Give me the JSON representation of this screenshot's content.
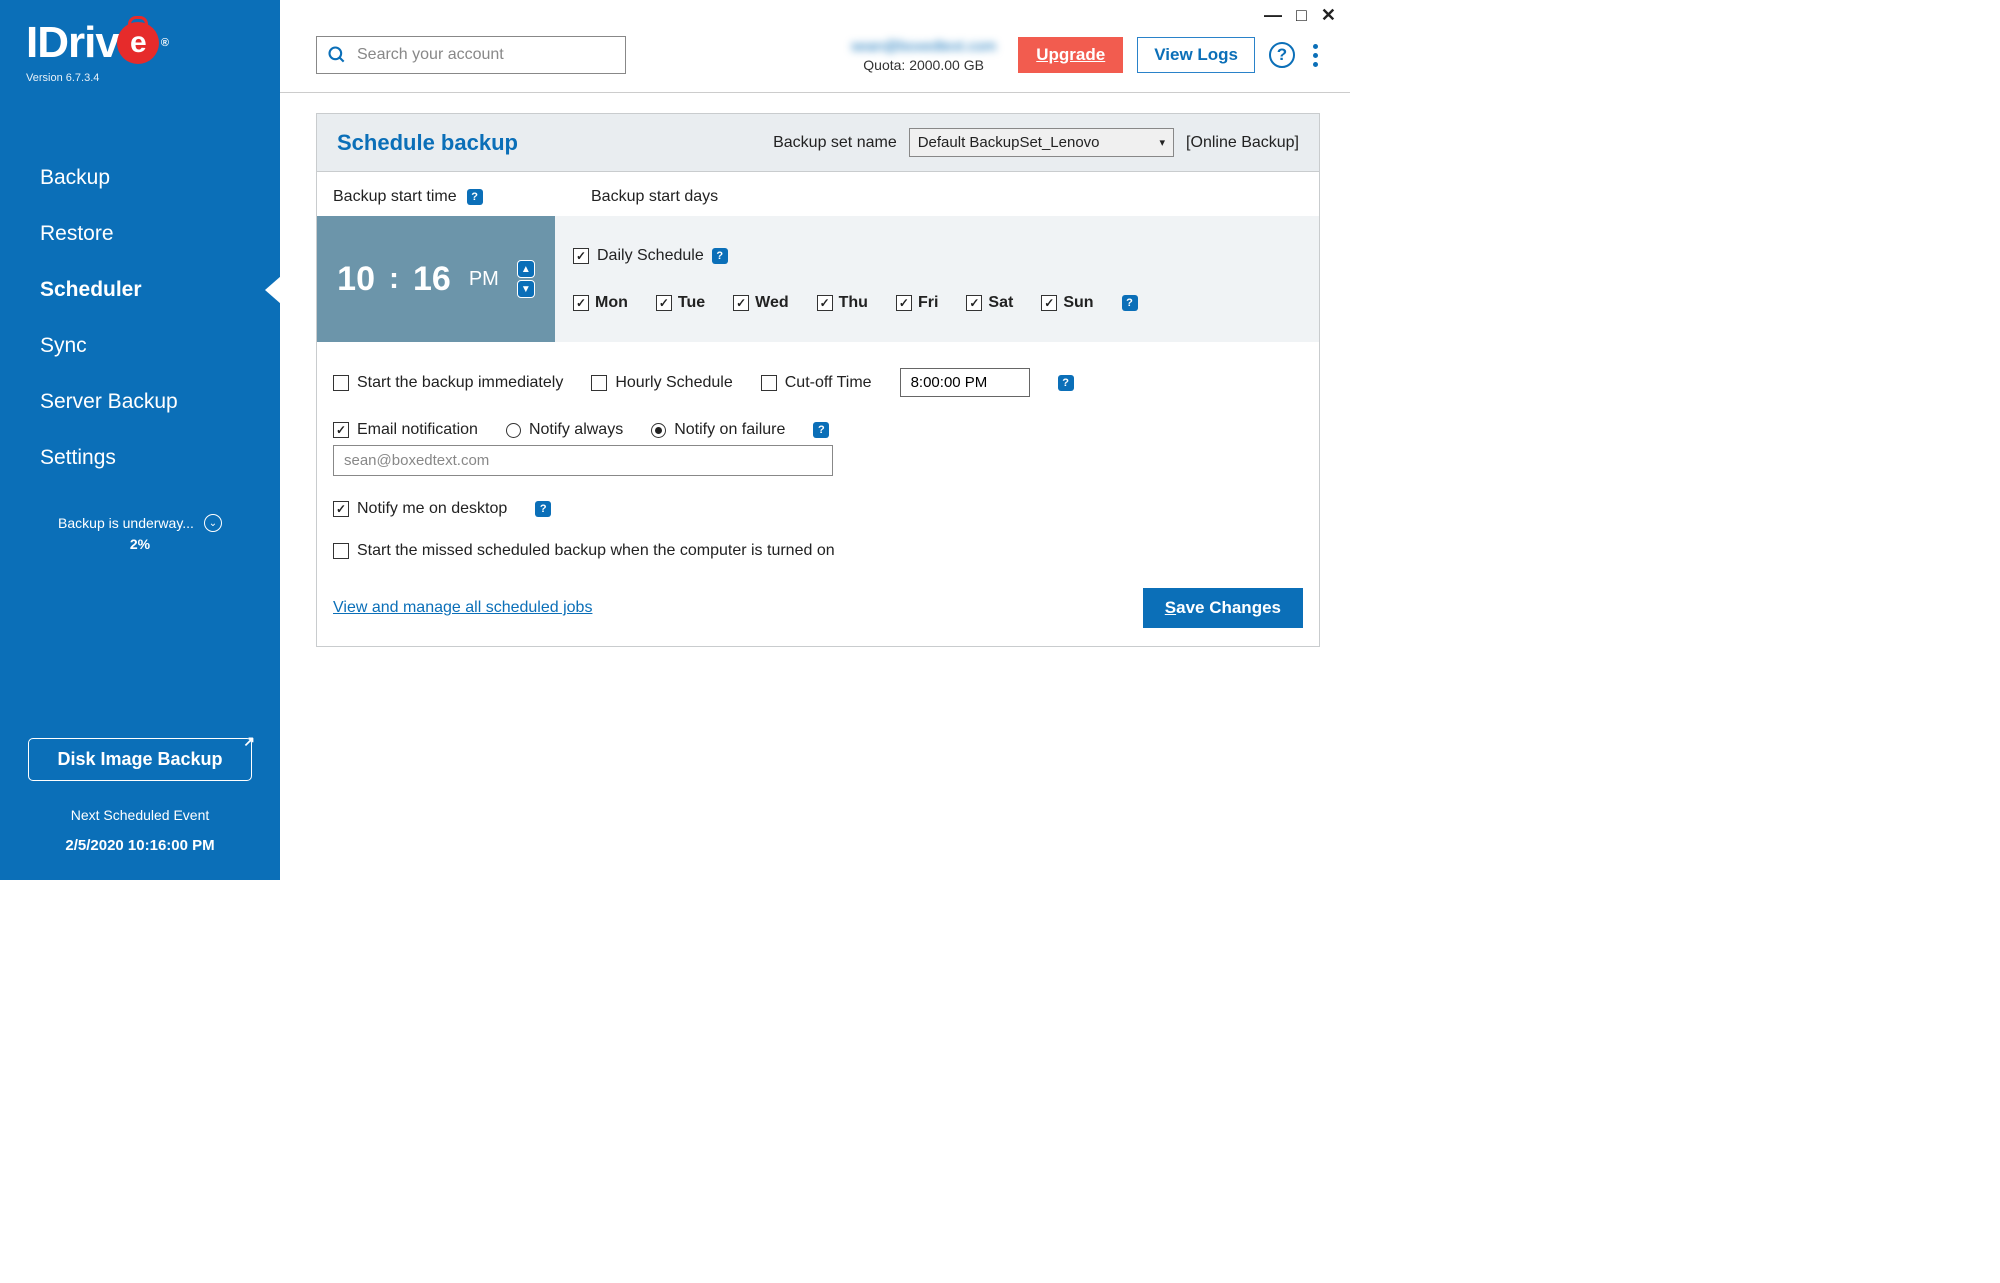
{
  "window": {
    "minimize": "—",
    "maximize": "□",
    "close": "✕"
  },
  "brand": {
    "name": "IDrive",
    "version": "Version  6.7.3.4",
    "registered": "®"
  },
  "sidebar": {
    "items": [
      {
        "label": "Backup"
      },
      {
        "label": "Restore"
      },
      {
        "label": "Scheduler"
      },
      {
        "label": "Sync"
      },
      {
        "label": "Server Backup"
      },
      {
        "label": "Settings"
      }
    ],
    "status_text": "Backup is underway...",
    "status_pct": "2%",
    "disk_image_btn": "Disk Image Backup",
    "next_event_label": "Next Scheduled Event",
    "next_event_time": "2/5/2020 10:16:00 PM"
  },
  "topbar": {
    "search_placeholder": "Search your account",
    "account_email": "sean@boxedtext.com",
    "quota": "Quota: 2000.00 GB",
    "upgrade": "Upgrade",
    "view_logs": "View Logs",
    "help": "?"
  },
  "panel": {
    "title": "Schedule backup",
    "backup_set_label": "Backup set name",
    "backup_set_value": "Default BackupSet_Lenovo",
    "mode_label": "[Online Backup]",
    "start_time_label": "Backup start time",
    "start_days_label": "Backup start days",
    "time_h": "10",
    "time_sep": ":",
    "time_m": "16",
    "time_ampm": "PM",
    "daily_label": "Daily Schedule",
    "days": [
      "Mon",
      "Tue",
      "Wed",
      "Thu",
      "Fri",
      "Sat",
      "Sun"
    ],
    "opt_immediate": "Start the backup immediately",
    "opt_hourly": "Hourly Schedule",
    "opt_cutoff": "Cut-off Time",
    "cutoff_value": "8:00:00 PM",
    "opt_email": "Email notification",
    "notify_always": "Notify always",
    "notify_failure": "Notify on failure",
    "email_value": "sean@boxedtext.com",
    "opt_desktop": "Notify me on desktop",
    "opt_missed": "Start the missed scheduled backup when the computer is turned on",
    "view_jobs_link": "View and manage all scheduled jobs",
    "save_prefix": "S",
    "save_rest": "ave Changes"
  }
}
